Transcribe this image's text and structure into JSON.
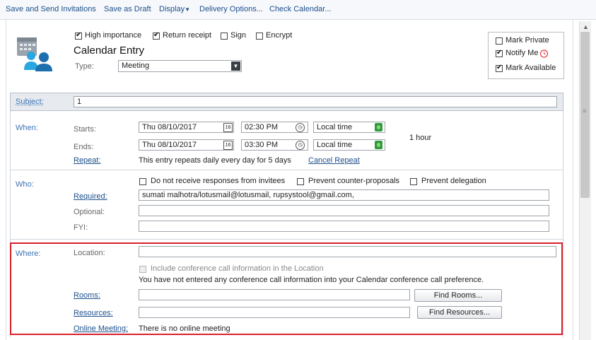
{
  "toolbar": {
    "save_send": "Save and Send Invitations",
    "save_draft": "Save as Draft",
    "display": "Display",
    "delivery": "Delivery Options...",
    "check_calendar": "Check Calendar..."
  },
  "header": {
    "options": {
      "high_importance": "High importance",
      "return_receipt": "Return receipt",
      "sign": "Sign",
      "encrypt": "Encrypt"
    },
    "title": "Calendar Entry",
    "type_label": "Type:",
    "type_value": "Meeting"
  },
  "side_options": {
    "mark_private": "Mark Private",
    "notify_me": "Notify Me",
    "mark_available": "Mark Available"
  },
  "subject": {
    "label": "Subject:",
    "value": "1"
  },
  "when": {
    "label": "When:",
    "starts_label": "Starts:",
    "ends_label": "Ends:",
    "start_date": "Thu 08/10/2017",
    "start_time": "02:30 PM",
    "end_date": "Thu 08/10/2017",
    "end_time": "03:30 PM",
    "timezone_start": "Local time",
    "timezone_end": "Local time",
    "duration": "1 hour",
    "calendar_icon_text": "16",
    "repeat_link": "Repeat:",
    "repeat_text": "This entry repeats daily every day for 5 days",
    "cancel_repeat": "Cancel Repeat"
  },
  "who": {
    "label": "Who:",
    "no_responses": "Do not receive responses from invitees",
    "prevent_counter": "Prevent counter-proposals",
    "prevent_delegation": "Prevent delegation",
    "required_link": "Required:",
    "required_value": "sumati malhotra/lotusmail@lotusmail, rupsystool@gmail.com,",
    "optional_label": "Optional:",
    "fyi_label": "FYI:"
  },
  "where": {
    "label": "Where:",
    "location_label": "Location:",
    "conference_checkbox": "Include conference call information in the Location",
    "conference_note": "You have not entered any conference call information into your Calendar conference call preference.",
    "rooms_link": "Rooms:",
    "find_rooms": "Find Rooms...",
    "resources_link": "Resources:",
    "find_resources": "Find Resources...",
    "online_meeting_link": "Online Meeting:",
    "online_meeting_text": "There is no online meeting"
  },
  "checkbox_state": {
    "high_importance": true,
    "return_receipt": true,
    "sign": false,
    "encrypt": false,
    "mark_private": false,
    "notify_me": true,
    "mark_available": true,
    "no_responses": false,
    "prevent_counter": false,
    "prevent_delegation": false,
    "conference_call": false
  },
  "colors": {
    "link": "#1d4f8c",
    "section_label": "#3d74b4",
    "highlight_border": "#d8202a"
  },
  "icons": {
    "calendar_entry": "calendar-people-icon",
    "calendar_picker": "calendar-icon",
    "time_picker": "clock-icon",
    "timezone": "globe-icon",
    "notify": "alarm-clock-icon",
    "dropdown": "dropdown-arrow-icon"
  }
}
